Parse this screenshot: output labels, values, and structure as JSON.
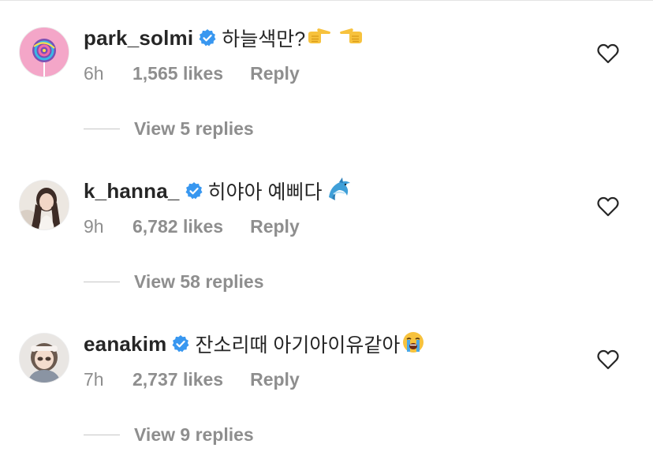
{
  "comments": [
    {
      "username": "park_solmi",
      "verified": true,
      "text": "하늘색만?",
      "emoji": [
        "pointing-right-emoji",
        "pointing-left-emoji"
      ],
      "time": "6h",
      "likes": "1,565 likes",
      "reply_label": "Reply",
      "view_replies": "View 5 replies",
      "avatar": "lollipop-avatar"
    },
    {
      "username": "k_hanna_",
      "verified": true,
      "text": "히야아 예삐다",
      "emoji": [
        "dolphin-emoji"
      ],
      "time": "9h",
      "likes": "6,782 likes",
      "reply_label": "Reply",
      "view_replies": "View 58 replies",
      "avatar": "photo-avatar"
    },
    {
      "username": "eanakim",
      "verified": true,
      "text": "잔소리때 아기아이유같아",
      "emoji": [
        "loudly-crying-face-emoji"
      ],
      "time": "7h",
      "likes": "2,737 likes",
      "reply_label": "Reply",
      "view_replies": "View 9 replies",
      "avatar": "photo-avatar"
    }
  ],
  "colors": {
    "primary_text": "#262626",
    "secondary_text": "#8e8e8e",
    "verified_blue": "#3897f0",
    "avatar_1_bg": "#f4a6c8"
  }
}
